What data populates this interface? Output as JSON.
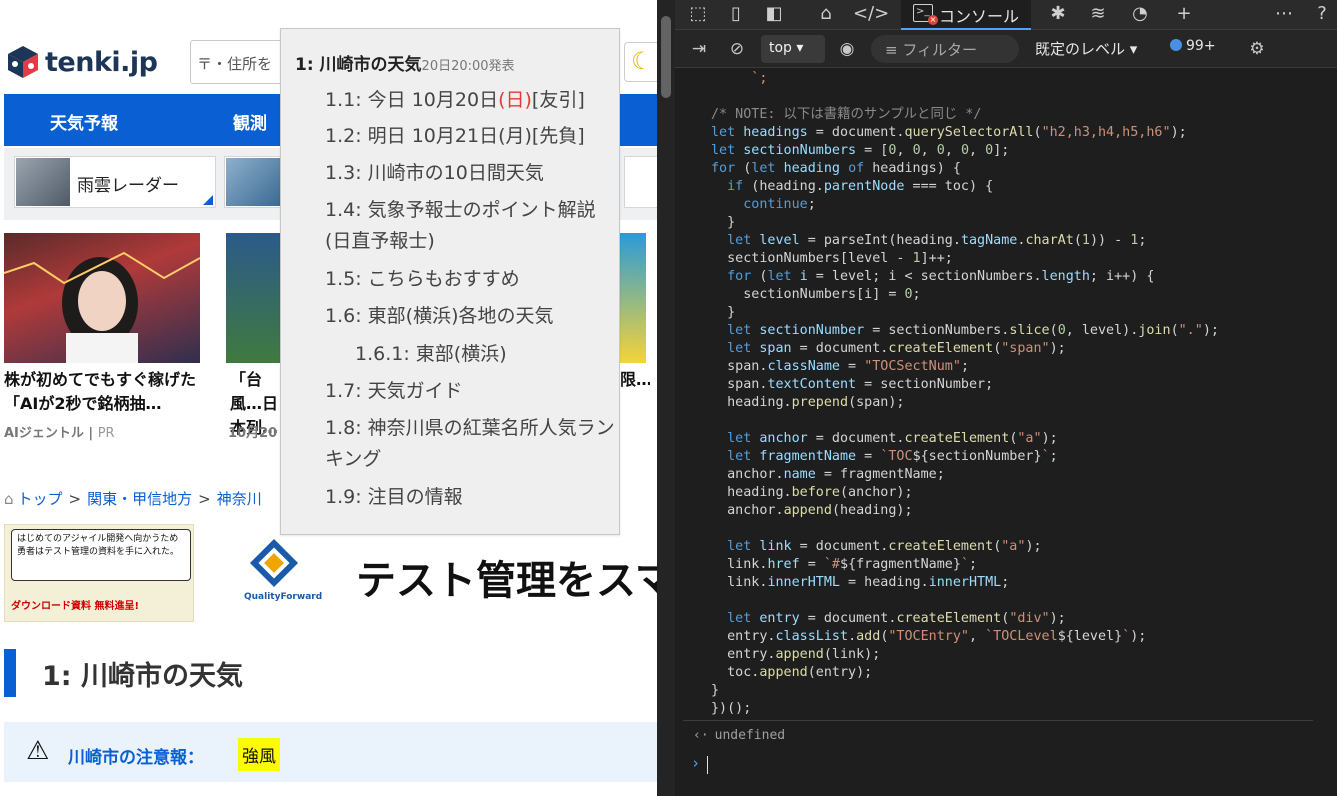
{
  "site": {
    "logo_text": "tenki.jp",
    "search_placeholder": "〒・住所を",
    "nav": [
      "天気予報",
      "観測"
    ],
    "quick_link": "雨雲レーダー",
    "articles": [
      {
        "title": "株が初めてでもすぐ稼げた「AIが2秒で銘柄抽…",
        "source": "AIジェントル",
        "tag": "PR"
      },
      {
        "title": "「台風…日本列…",
        "date": "10月20"
      },
      {
        "title": "限…",
        "date": ""
      }
    ],
    "breadcrumb": [
      "トップ",
      "関東・甲信地方",
      "神奈川"
    ],
    "ad": {
      "bubble": "はじめてのアジャイル開発へ向かうため勇者はテスト管理の資料を手に入れた。",
      "download": "ダウンロード資料 無料進呈!",
      "brand": "QualityForward",
      "headline": "テスト管理をスマ"
    },
    "heading1": "1: 川崎市の天気",
    "alert": {
      "label": "川崎市の注意報：",
      "value": "強風"
    }
  },
  "toc": {
    "header": "1: 川崎市の天気",
    "header_note": "20日20:00発表",
    "entries": [
      {
        "num": "1.1:",
        "text": "今日 10月20日",
        "red": "(日)",
        "tail": "[友引]"
      },
      {
        "num": "1.2:",
        "text": "明日 10月21日(月)[先負]"
      },
      {
        "num": "1.3:",
        "text": "川崎市の10日間天気"
      },
      {
        "num": "1.4:",
        "text": "気象予報士のポイント解説(日直予報士)"
      },
      {
        "num": "1.5:",
        "text": "こちらもおすすめ"
      },
      {
        "num": "1.6:",
        "text": "東部(横浜)各地の天気"
      },
      {
        "num": "1.6.1:",
        "text": "東部(横浜)"
      },
      {
        "num": "1.7:",
        "text": "天気ガイド"
      },
      {
        "num": "1.8:",
        "text": "神奈川県の紅葉名所人気ランキング"
      },
      {
        "num": "1.9:",
        "text": "注目の情報"
      }
    ]
  },
  "devtools": {
    "console_tab": "コンソール",
    "context": "top",
    "filter_placeholder": "フィルター",
    "levels": "既定のレベル",
    "issues_count": "99+",
    "result": "undefined"
  }
}
